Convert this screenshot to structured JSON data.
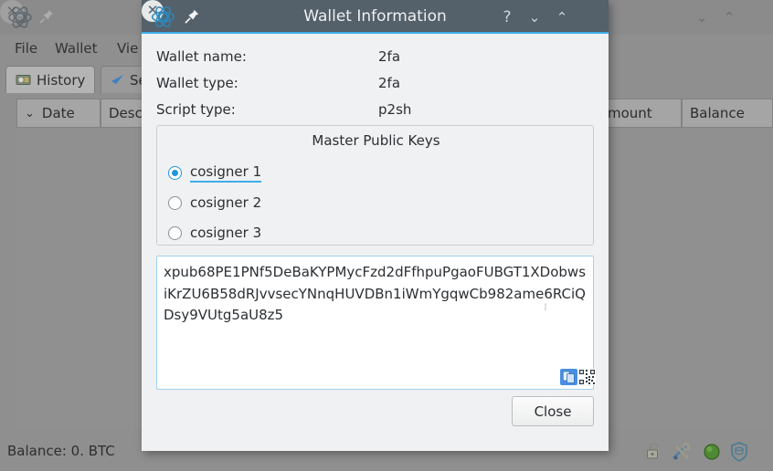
{
  "background_window": {
    "logo_icon": "electrum-atom-logo",
    "pin_icon": "pin-icon",
    "window_controls": {
      "minimize": "⌄",
      "maximize": "⌃",
      "close": "✕"
    },
    "menus": [
      {
        "label": "File"
      },
      {
        "label": "Wallet"
      },
      {
        "label": "Vie"
      }
    ],
    "tabs": [
      {
        "label": "History",
        "icon": "history-banknote-icon",
        "active": true
      },
      {
        "label": "Se",
        "icon": "send-arrow-icon",
        "active": false
      }
    ],
    "table_headers": {
      "sort_chevron": "⌄",
      "date": "Date",
      "description": "Desc",
      "amount": "mount",
      "balance": "Balance"
    },
    "statusbar": {
      "balance_text": "Balance: 0. BTC",
      "icons": [
        {
          "name": "lock-open-icon"
        },
        {
          "name": "tools-icon"
        },
        {
          "name": "network-status-icon"
        },
        {
          "name": "shield-seed-icon"
        }
      ]
    }
  },
  "dialog": {
    "title": "Wallet Information",
    "logo_icon": "electrum-atom-logo",
    "pin_icon": "pin-icon",
    "window_controls": {
      "help": "?",
      "minimize": "⌄",
      "maximize": "⌃",
      "close": "✕"
    },
    "fields": [
      {
        "label": "Wallet name:",
        "value": "2fa"
      },
      {
        "label": "Wallet type:",
        "value": "2fa"
      },
      {
        "label": "Script type:",
        "value": "p2sh"
      }
    ],
    "master_public_keys": {
      "title": "Master Public Keys",
      "options": [
        {
          "label": "cosigner 1",
          "selected": true,
          "focused": true
        },
        {
          "label": "cosigner 2",
          "selected": false,
          "focused": false
        },
        {
          "label": "cosigner 3",
          "selected": false,
          "focused": false
        }
      ]
    },
    "xpub": {
      "value": "xpub68PE1PNf5DeBaKYPMycFzd2dFfhpuPgaoFUBGT1XDobwsiKrZU6B58dRJvvsecYNnqHUVDBn1iWmYgqwCb982ame6RCiQDsy9VUtg5aU8z5",
      "copy_icon": "copy-icon",
      "qr_icon": "qr-code-icon"
    },
    "close_label": "Close"
  },
  "colors": {
    "dialog_titlebar": "#54606a",
    "accent_blue": "#3daee9",
    "radio_blue": "#2196d6",
    "dialog_bg": "#f0f1f2",
    "overlay_gray": "#8f8f8f"
  }
}
